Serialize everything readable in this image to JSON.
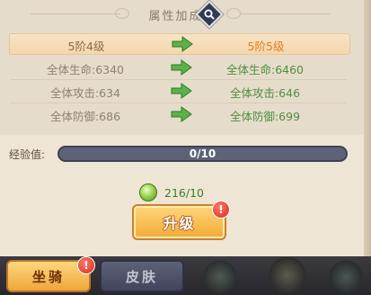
{
  "header": {
    "title": "属性加成"
  },
  "rows": [
    {
      "left": "5阶4级",
      "right": "5阶5级"
    },
    {
      "left": "全体生命:6340",
      "right": "全体生命:6460"
    },
    {
      "left": "全体攻击:634",
      "right": "全体攻击:646"
    },
    {
      "left": "全体防御:686",
      "right": "全体防御:699"
    }
  ],
  "experience": {
    "label": "经验值:",
    "value_text": "0/10",
    "progress": 0.0
  },
  "cost": {
    "text": "216/10",
    "icon": "green-gem-icon"
  },
  "upgrade": {
    "label": "升级",
    "badge": "!"
  },
  "tabs": [
    {
      "label": "坐骑",
      "active": true,
      "badge": "!"
    },
    {
      "label": "皮肤",
      "active": false
    }
  ],
  "colors": {
    "accent": "#f2aa35",
    "up_value": "#4f8f3f",
    "highlight_value": "#e27c1a"
  }
}
